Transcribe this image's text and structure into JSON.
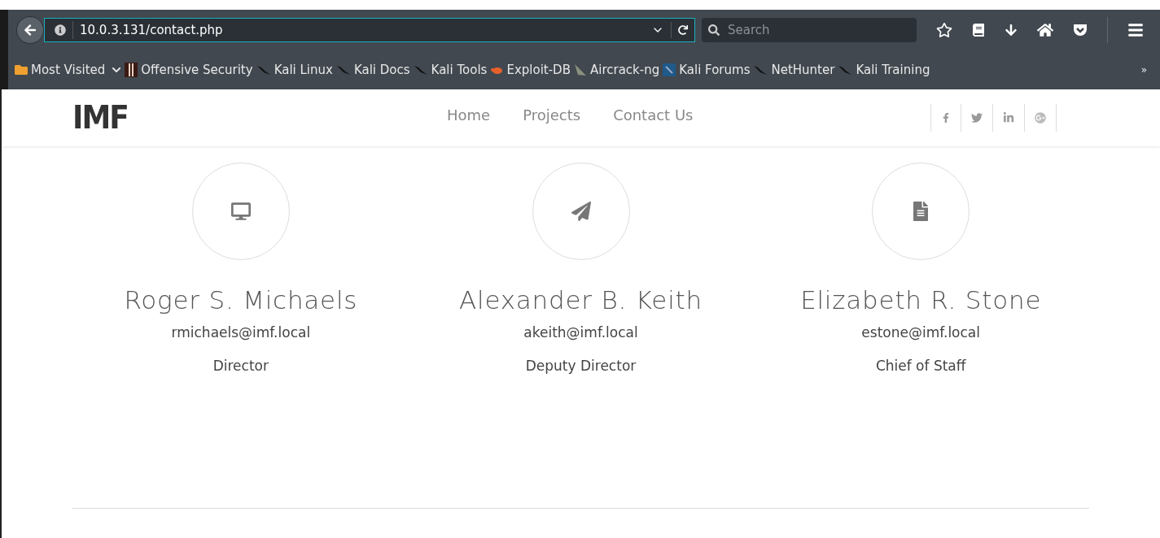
{
  "browser": {
    "url": "10.0.3.131/contact.php",
    "search": {
      "placeholder": "Search"
    },
    "bookmarks": [
      {
        "label": "Most Visited",
        "kind": "folder"
      },
      {
        "label": "Offensive Security",
        "kind": "offsec"
      },
      {
        "label": "Kali Linux",
        "kind": "kali"
      },
      {
        "label": "Kali Docs",
        "kind": "kali"
      },
      {
        "label": "Kali Tools",
        "kind": "kali"
      },
      {
        "label": "Exploit-DB",
        "kind": "exploit"
      },
      {
        "label": "Aircrack-ng",
        "kind": "aircrack"
      },
      {
        "label": "Kali Forums",
        "kind": "forums"
      },
      {
        "label": "NetHunter",
        "kind": "kali"
      },
      {
        "label": "Kali Training",
        "kind": "kali"
      }
    ],
    "overflow": "»"
  },
  "site": {
    "logo": "IMF",
    "nav": [
      {
        "label": "Home"
      },
      {
        "label": "Projects"
      },
      {
        "label": "Contact Us"
      }
    ],
    "people": [
      {
        "kind": "monitor",
        "name": "Roger S. Michaels",
        "email": "rmichaels@imf.local",
        "role": "Director"
      },
      {
        "kind": "plane",
        "name": "Alexander B. Keith",
        "email": "akeith@imf.local",
        "role": "Deputy Director"
      },
      {
        "kind": "document",
        "name": "Elizabeth R. Stone",
        "email": "estone@imf.local",
        "role": "Chief of Staff"
      }
    ]
  }
}
